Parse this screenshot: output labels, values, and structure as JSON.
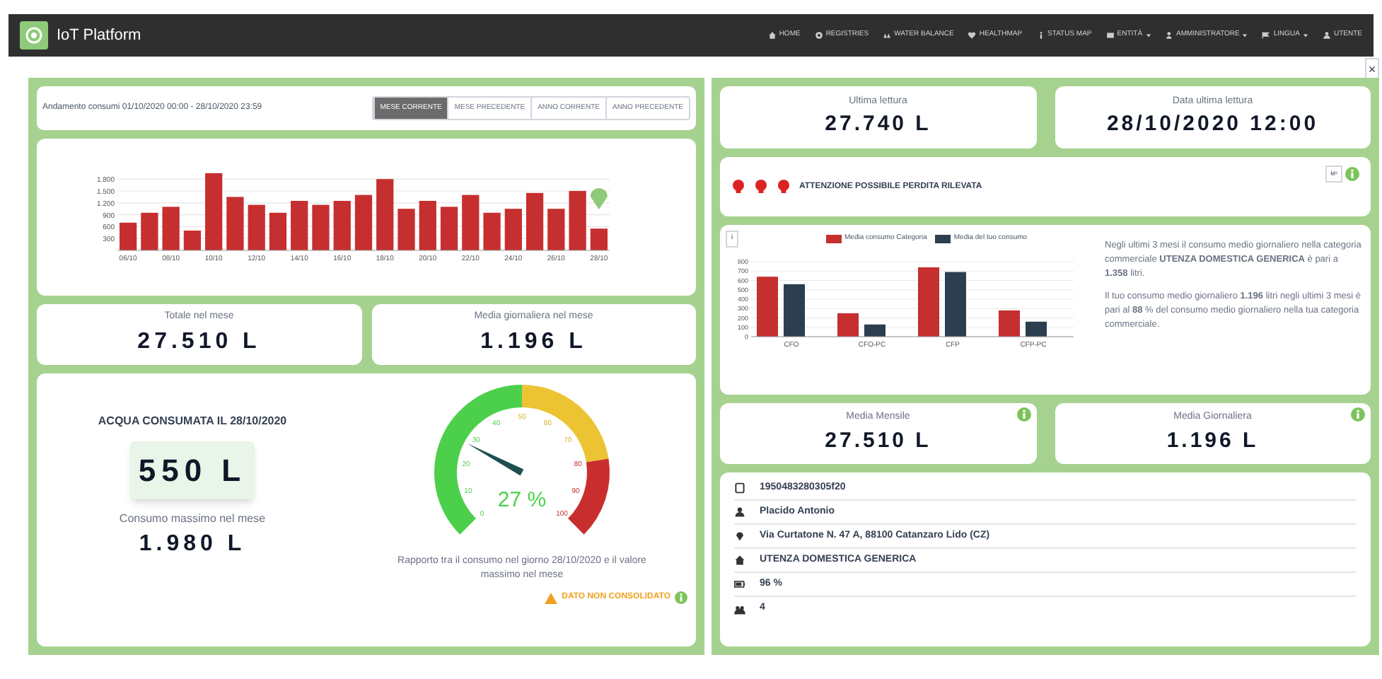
{
  "navbar": {
    "brand": "IoT Platform",
    "items": [
      {
        "label": "HOME",
        "dropdown": false
      },
      {
        "label": "REGISTRIES",
        "dropdown": false
      },
      {
        "label": "WATER BALANCE",
        "dropdown": false
      },
      {
        "label": "HEALTHMAP",
        "dropdown": false
      },
      {
        "label": "STATUS MAP",
        "dropdown": false
      },
      {
        "label": "ENTITÀ",
        "dropdown": true
      },
      {
        "label": "AMMINISTRATORE",
        "dropdown": true
      },
      {
        "label": "LINGUA",
        "dropdown": true
      },
      {
        "label": "UTENTE",
        "dropdown": false
      }
    ]
  },
  "close_button": "×",
  "period": {
    "label": "Andamento consumi 01/10/2020 00:00 - 28/10/2020 23:59",
    "tabs": [
      {
        "label": "MESE CORRENTE",
        "selected": true
      },
      {
        "label": "MESE PRECEDENTE",
        "selected": false
      },
      {
        "label": "ANNO CORRENTE",
        "selected": false
      },
      {
        "label": "ANNO PRECEDENTE",
        "selected": false
      }
    ]
  },
  "daily_chart": {
    "chart_data": {
      "type": "bar",
      "categories": [
        "06/10",
        null,
        "08/10",
        null,
        "10/10",
        null,
        "12/10",
        null,
        "14/10",
        null,
        "16/10",
        null,
        "18/10",
        null,
        "20/10",
        null,
        "22/10",
        null,
        "24/10",
        null,
        "26/10",
        null,
        "28/10"
      ],
      "series": [
        {
          "color": "#c62f2f",
          "values": [
            700,
            950,
            1100,
            500,
            1950,
            1350,
            1150,
            950,
            1250,
            1150,
            1250,
            1400,
            1800,
            1050,
            1250,
            1100,
            1400,
            950,
            1050,
            1450,
            1050,
            1500,
            550
          ]
        }
      ],
      "ylim": [
        0,
        2000
      ],
      "grid": true,
      "yticks": [
        {
          "value": 300,
          "label": "300"
        },
        {
          "value": 600,
          "label": "600"
        },
        {
          "value": 900,
          "label": "900"
        },
        {
          "value": 1200,
          "label": "1.200"
        },
        {
          "value": 1500,
          "label": "1.500"
        },
        {
          "value": 1800,
          "label": "1.800"
        }
      ]
    }
  },
  "month_stats": [
    {
      "label": "Totale nel mese",
      "value": "27.510 L"
    },
    {
      "label": "Media giornaliera nel mese",
      "value": "1.196 L"
    }
  ],
  "today": {
    "title": "ACQUA CONSUMATA IL 28/10/2020",
    "value": "550 L",
    "max_label": "Consumo massimo nel mese",
    "max_value": "1.980 L"
  },
  "gauge": {
    "reading": "27 %",
    "scale": [
      "0",
      "10",
      "20",
      "30",
      "40",
      "50",
      "60",
      "70",
      "80",
      "90",
      "100"
    ],
    "caption": "Rapporto tra il consumo nel giorno 28/10/2020 e il valore massimo nel mese",
    "warning": "DATO NON CONSOLIDATO"
  },
  "readings": [
    {
      "label": "Ultima lettura",
      "value": "27.740 L"
    },
    {
      "label": "Data ultima lettura",
      "value": "28/10/2020 12:00"
    }
  ],
  "alert": {
    "text": "ATTENZIONE POSSIBILE PERDITA RILEVATA",
    "button": "M³"
  },
  "comparison": {
    "button": "i",
    "chart_data": {
      "type": "bar",
      "categories": [
        "CFO",
        "CFO-PC",
        "CFP",
        "CFP-PC"
      ],
      "series": [
        {
          "name": "Media consumo Categoria",
          "color": "#c62f2f",
          "values": [
            640,
            250,
            740,
            280
          ]
        },
        {
          "name": "Media del tuo consumo",
          "color": "#2c3e50",
          "values": [
            560,
            130,
            690,
            160
          ]
        }
      ],
      "ylim": [
        0,
        800
      ],
      "grid": true,
      "yticks": [
        0,
        100,
        200,
        300,
        400,
        500,
        600,
        700,
        800
      ]
    },
    "paragraphs": [
      "Negli ultimi 3 mesi il consumo medio giornaliero nella categoria commerciale **UTENZA DOMESTICA GENERICA** è pari a **1.358** litri.",
      "Il tuo consumo medio giornaliero **1.196** litri negli ultimi 3 mesi è pari al **88** % del consumo medio giornaliero nella tua categoria commerciale."
    ]
  },
  "averages": [
    {
      "label": "Media Mensile",
      "value": "27.510 L"
    },
    {
      "label": "Media Giornaliera",
      "value": "1.196 L"
    }
  ],
  "details": [
    {
      "kind": "device",
      "text": "1950483280305f20"
    },
    {
      "kind": "person",
      "text": "Placido Antonio"
    },
    {
      "kind": "location",
      "text": "Via Curtatone N. 47 A, 88100 Catanzaro Lido (CZ)"
    },
    {
      "kind": "home",
      "text": "UTENZA DOMESTICA GENERICA"
    },
    {
      "kind": "battery",
      "text": "96 %"
    },
    {
      "kind": "group",
      "text": "4"
    }
  ]
}
